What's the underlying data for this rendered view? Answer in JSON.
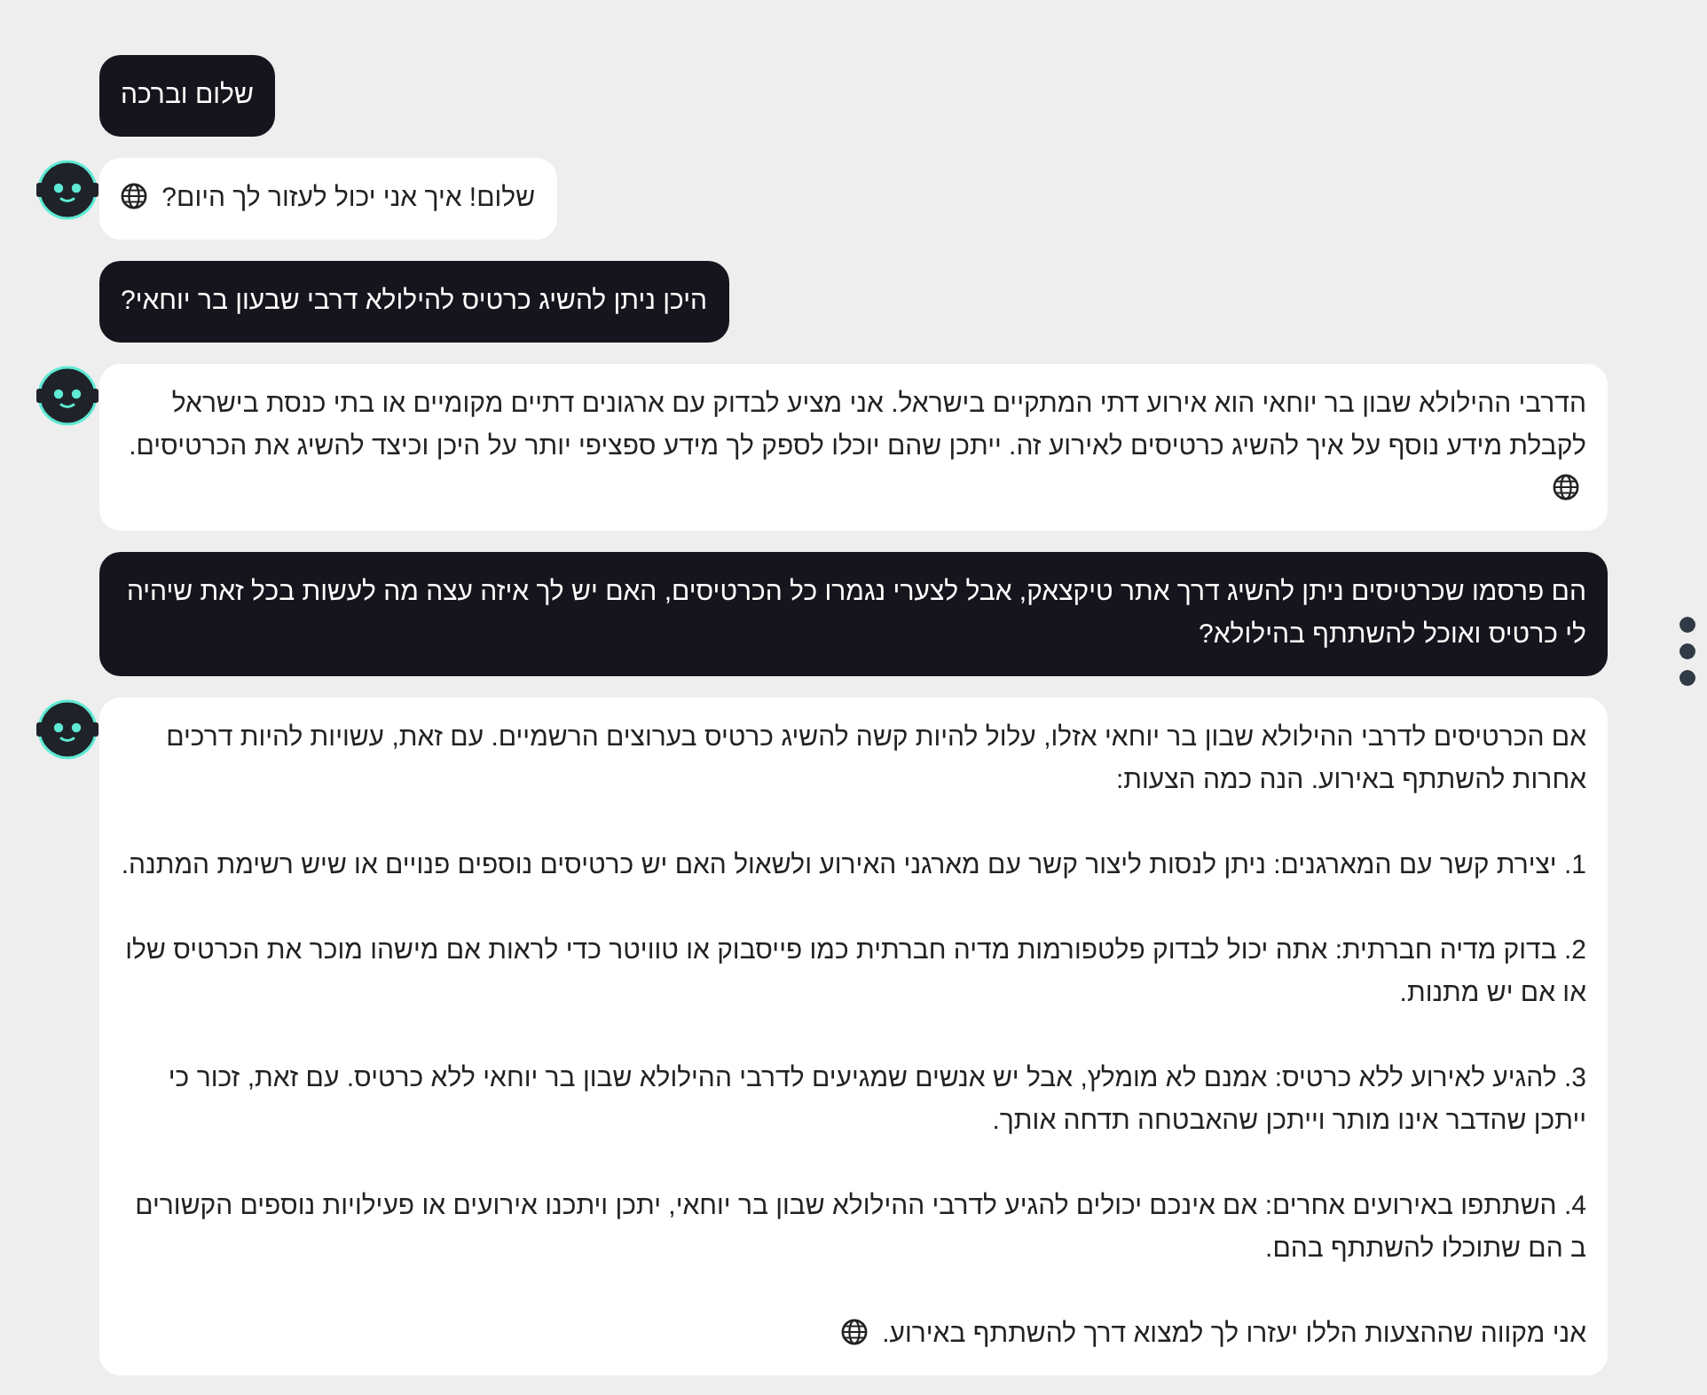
{
  "messages": [
    {
      "kind": "user",
      "paragraphs": [
        "שלום וברכה"
      ]
    },
    {
      "kind": "bot",
      "paragraphs": [
        "שלום! איך אני יכול לעזור לך היום?"
      ]
    },
    {
      "kind": "user",
      "paragraphs": [
        "היכן ניתן להשיג כרטיס להילולא דרבי שבעון בר יוחאי?"
      ]
    },
    {
      "kind": "bot",
      "paragraphs": [
        "הדרבי ההילולא שבון בר יוחאי הוא אירוע דתי המתקיים בישראל. אני מציע לבדוק עם ארגונים דתיים מקומיים או בתי כנסת בישראל לקבלת מידע נוסף על איך להשיג כרטיסים לאירוע זה. ייתכן שהם יוכלו לספק לך מידע ספציפי יותר על היכן וכיצד להשיג את הכרטיסים."
      ]
    },
    {
      "kind": "user",
      "paragraphs": [
        "הם פרסמו שכרטיסים ניתן להשיג דרך אתר טיקצאק, אבל לצערי נגמרו כל הכרטיסים, האם יש לך איזה עצה מה לעשות בכל זאת שיהיה לי כרטיס ואוכל להשתתף בהילולא?"
      ]
    },
    {
      "kind": "bot",
      "paragraphs": [
        "אם הכרטיסים לדרבי ההילולא שבון בר יוחאי אזלו, עלול להיות קשה להשיג כרטיס בערוצים הרשמיים. עם זאת, עשויות להיות דרכים אחרות להשתתף באירוע. הנה כמה הצעות:",
        "1. יצירת קשר עם המארגנים: ניתן לנסות ליצור קשר עם מארגני האירוע ולשאול האם יש כרטיסים נוספים פנויים או שיש רשימת המתנה.",
        "2. בדוק מדיה חברתית: אתה יכול לבדוק פלטפורמות מדיה חברתית כמו פייסבוק או טוויטר כדי לראות אם מישהו מוכר את הכרטיס שלו או אם יש מתנות.",
        "3. להגיע לאירוע ללא כרטיס: אמנם לא מומלץ, אבל יש אנשים שמגיעים לדרבי ההילולא שבון בר יוחאי ללא כרטיס. עם זאת, זכור כי ייתכן שהדבר אינו מותר וייתכן שהאבטחה תדחה אותך.",
        "4. השתתפו באירועים אחרים: אם אינכם יכולים להגיע לדרבי ההילולא שבון בר יוחאי, יתכן ויתכנו אירועים או פעילויות נוספים הקשורים ב הם שתוכלו להשתתף בהם.",
        "אני מקווה שההצעות הללו יעזרו לך למצוא דרך להשתתף באירוע."
      ]
    }
  ]
}
